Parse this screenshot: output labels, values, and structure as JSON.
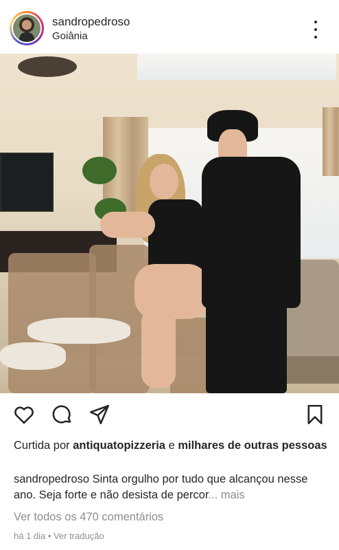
{
  "post": {
    "username": "sandropedroso",
    "location": "Goiânia"
  },
  "icons": {
    "avatar": "profile-avatar",
    "menu": "more-options-icon",
    "like": "heart-icon",
    "comment": "comment-icon",
    "share": "send-icon",
    "save": "bookmark-icon"
  },
  "likes": {
    "prefix": "Curtida por ",
    "user": "antiquatopizzeria",
    "connector": " e ",
    "others": "milhares de outras pessoas"
  },
  "caption": {
    "username": "sandropedroso",
    "text": " Sinta orgulho por tudo que alcançou nesse ano. Seja forte e não desista de percor",
    "ellipsis": "...",
    "more": " mais"
  },
  "comments": {
    "label": "Ver todos os 470 comentários"
  },
  "meta": {
    "time": "há 1 dia",
    "separator": " • ",
    "translate": "Ver tradução"
  },
  "colors": {
    "text": "#262626",
    "muted": "#8e8e8e",
    "background": "#ffffff"
  }
}
